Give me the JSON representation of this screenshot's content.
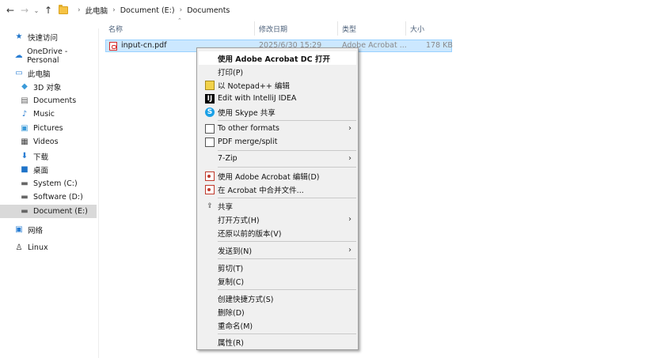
{
  "addressbar": {
    "back_glyph": "←",
    "forward_glyph": "→",
    "recent_glyph": "⌄",
    "up_glyph": "↑",
    "breadcrumbs": [
      "此电脑",
      "Document (E:)",
      "Documents"
    ]
  },
  "sidebar": {
    "items": [
      {
        "label": "快速访问",
        "icon": "star-icon"
      },
      {
        "label": "OneDrive - Personal",
        "icon": "cloud-icon"
      },
      {
        "label": "此电脑",
        "icon": "computer-icon"
      },
      {
        "label": "3D 对象",
        "icon": "cube-icon"
      },
      {
        "label": "Documents",
        "icon": "document-icon"
      },
      {
        "label": "Music",
        "icon": "music-icon"
      },
      {
        "label": "Pictures",
        "icon": "picture-icon"
      },
      {
        "label": "Videos",
        "icon": "video-icon"
      },
      {
        "label": "下载",
        "icon": "download-icon"
      },
      {
        "label": "桌面",
        "icon": "desktop-icon"
      },
      {
        "label": "System (C:)",
        "icon": "drive-icon"
      },
      {
        "label": "Software (D:)",
        "icon": "drive-icon"
      },
      {
        "label": "Document (E:)",
        "icon": "drive-icon"
      },
      {
        "label": "网络",
        "icon": "network-icon"
      },
      {
        "label": "Linux",
        "icon": "linux-icon"
      }
    ]
  },
  "columns": {
    "name": "名称",
    "modified": "修改日期",
    "type": "类型",
    "size": "大小"
  },
  "file": {
    "name": "input-cn.pdf",
    "modified": "2025/6/30 15:29",
    "type": "Adobe Acrobat ...",
    "size": "178 KB"
  },
  "menu": {
    "items": [
      {
        "label": "使用 Adobe Acrobat DC 打开"
      },
      {
        "label": "打印(P)"
      },
      {
        "label": "以 Notepad++ 编辑",
        "icon": "notepadpp-icon"
      },
      {
        "label": "Edit with IntelliJ IDEA",
        "icon": "intellij-icon"
      },
      {
        "label": "使用 Skype 共享",
        "icon": "skype-icon"
      },
      {
        "label": "To other formats",
        "icon": "convert-icon"
      },
      {
        "label": "PDF merge/split",
        "icon": "merge-icon"
      },
      {
        "label": "7-Zip"
      },
      {
        "label": "使用 Adobe Acrobat 编辑(D)",
        "icon": "acrobat-edit-icon"
      },
      {
        "label": "在 Acrobat 中合并文件...",
        "icon": "acrobat-combine-icon"
      },
      {
        "label": "共享",
        "icon": "share-icon"
      },
      {
        "label": "打开方式(H)"
      },
      {
        "label": "还原以前的版本(V)"
      },
      {
        "label": "发送到(N)"
      },
      {
        "label": "剪切(T)"
      },
      {
        "label": "复制(C)"
      },
      {
        "label": "创建快捷方式(S)"
      },
      {
        "label": "删除(D)"
      },
      {
        "label": "重命名(M)"
      },
      {
        "label": "属性(R)"
      }
    ],
    "submenu_glyph": "›"
  },
  "colors": {
    "selection_bg": "#cce8ff",
    "selection_border": "#99d1ff",
    "menu_bg": "#f0f0f0",
    "nav_selected": "#d9d9d9"
  }
}
